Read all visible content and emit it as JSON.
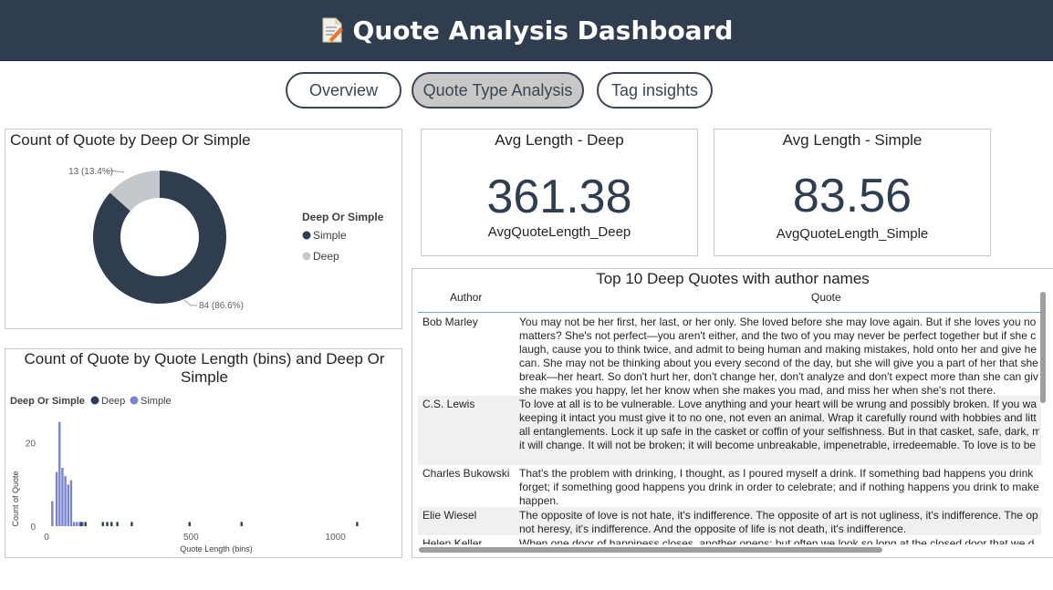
{
  "header": {
    "title": "Quote Analysis Dashboard",
    "icon": "memo-icon"
  },
  "tabs": [
    {
      "label": "Overview",
      "active": false
    },
    {
      "label": "Quote Type Analysis",
      "active": true
    },
    {
      "label": "Tag insights",
      "active": false
    }
  ],
  "donut": {
    "title": "Count of Quote by Deep Or Simple",
    "legend_title": "Deep Or Simple",
    "colors": {
      "Simple": "#2f3d4f",
      "Deep": "#c4c7cc"
    },
    "chart_data": {
      "type": "pie",
      "title": "Count of Quote by Deep Or Simple",
      "categories": [
        "Simple",
        "Deep"
      ],
      "values": [
        84,
        13
      ],
      "data_labels": [
        "84 (86.6%)",
        "13 (13.4%)"
      ],
      "legend_placement": "right"
    }
  },
  "cards": [
    {
      "title": "Avg Length - Deep",
      "value": "361.38",
      "label": "AvgQuoteLength_Deep"
    },
    {
      "title": "Avg Length - Simple",
      "value": "83.56",
      "label": "AvgQuoteLength_Simple"
    }
  ],
  "histogram": {
    "title_line1": "Count of Quote by Quote Length (bins) and Deep Or",
    "title_line2": "Simple",
    "legend_title": "Deep Or Simple",
    "colors": {
      "Deep": "#2f3d4f",
      "Simple": "#7a84cc"
    },
    "chart_data": {
      "type": "bar",
      "title": "Count of Quote by Quote Length (bins) and Deep Or Simple",
      "xlabel": "Quote Length (bins)",
      "ylabel": "Count of Quote",
      "xlim": [
        0,
        1080
      ],
      "ylim": [
        0,
        28
      ],
      "x_ticks": [
        "0",
        "500",
        "1000"
      ],
      "y_ticks": [
        "0",
        "20"
      ],
      "series": [
        {
          "name": "Simple",
          "x": [
            20,
            35,
            45,
            55,
            65,
            75,
            85,
            95,
            105,
            115,
            125
          ],
          "values": [
            6,
            13,
            25,
            14,
            12,
            10,
            11,
            1,
            1,
            1,
            1
          ]
        },
        {
          "name": "Deep",
          "x": [
            120,
            135,
            195,
            210,
            225,
            245,
            295,
            495,
            675,
            1075
          ],
          "values": [
            1,
            1,
            1,
            1,
            1,
            1,
            1,
            1,
            1,
            1
          ]
        }
      ],
      "legend_placement": "top-left"
    }
  },
  "table": {
    "title": "Top 10 Deep Quotes with author names",
    "columns": [
      "Author",
      "Quote"
    ],
    "rows": [
      {
        "author": "Bob Marley",
        "lines": [
          "You may not be her first, her last, or her only. She loved before she may love again. But if she loves you no",
          "matters? She's not perfect—you aren't either, and the two of you may never be perfect together but if she c",
          "laugh, cause you to think twice, and admit to being human and making mistakes, hold onto her and give he",
          "can. She may not be thinking about you every second of the day, but she will give you a part of her that she",
          "break—her heart. So don't hurt her, don't change her, don't analyze and don't expect more than she can giv",
          "she makes you happy, let her know when she makes you mad, and miss her when she's not there."
        ]
      },
      {
        "author": "C.S. Lewis",
        "lines": [
          "To love at all is to be vulnerable. Love anything and your heart will be wrung and possibly broken. If you wa",
          "keeping it intact you must give it to no one, not even an animal. Wrap it carefully round with hobbies and litt",
          "all entanglements. Lock it up safe in the casket or coffin of your selfishness. But in that casket, safe, dark, m",
          "it will change. It will not be broken; it will become unbreakable, impenetrable, irredeemable. To love is to be"
        ]
      },
      {
        "author": "Charles Bukowski",
        "lines": [
          "That's the problem with drinking, I thought, as I poured myself a drink. If something bad happens you drink",
          "forget; if something good happens you drink in order to celebrate; and if nothing happens you drink to make",
          "happen."
        ]
      },
      {
        "author": "Elie Wiesel",
        "lines": [
          "The opposite of love is not hate, it's indifference. The opposite of art is not ugliness, it's indifference. The op",
          "not heresy, it's indifference. And the opposite of life is not death, it's indifference."
        ]
      },
      {
        "author": "Helen Keller",
        "lines": [
          "When one door of happiness closes, another opens; but often we look so long at the closed door that we d"
        ]
      }
    ]
  }
}
